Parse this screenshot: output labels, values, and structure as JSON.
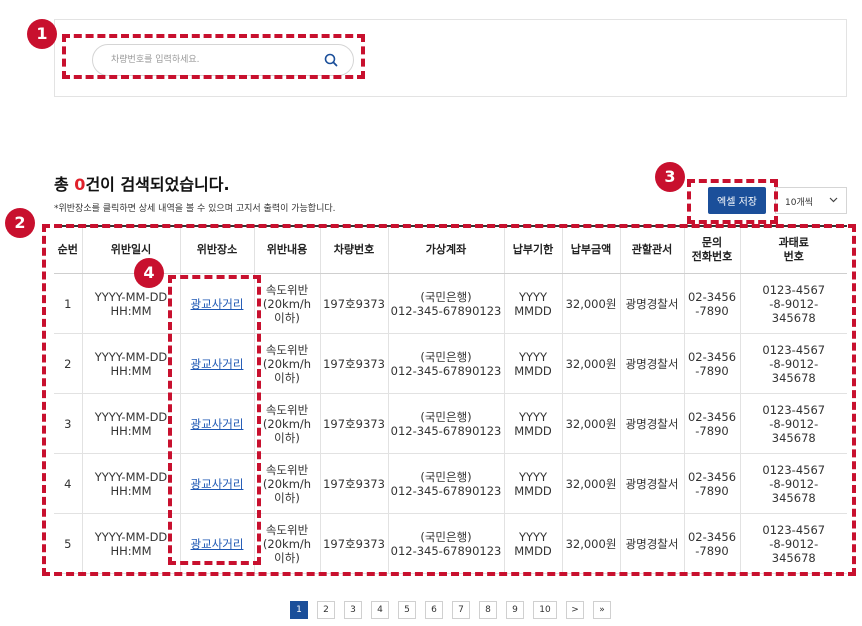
{
  "search": {
    "placeholder": "차량번호를 입력하세요."
  },
  "markers": [
    "1",
    "2",
    "3",
    "4"
  ],
  "results": {
    "title_prefix": "총 ",
    "count": "0",
    "title_suffix": "건이 검색되었습니다.",
    "note": "*위반장소를 클릭하면 상세 내역을 볼 수 있으며 고지서 출력이 가능합니다."
  },
  "toolbar": {
    "excel_label": "엑셀 저장",
    "page_size_label": "10개씩"
  },
  "table": {
    "headers": [
      "순번",
      "위반일시",
      "위반장소",
      "위반내용",
      "차량번호",
      "가상계좌",
      "납부기한",
      "납부금액",
      "관할관서",
      "문의\n전화번호",
      "과태료\n번호"
    ],
    "rows": [
      {
        "no": "1",
        "datetime": "YYYY-MM-DD\nHH:MM",
        "location": "광교사거리",
        "content": "속도위반\n(20km/h 이하)",
        "plate": "197호9373",
        "account": "(국민은행)\n012-345-67890123",
        "due": "YYYY\nMMDD",
        "amount": "32,000원",
        "office": "광명경찰서",
        "phone": "02-3456\n-7890",
        "fine_no": "0123-4567\n-8-9012-\n345678"
      },
      {
        "no": "2",
        "datetime": "YYYY-MM-DD\nHH:MM",
        "location": "광교사거리",
        "content": "속도위반\n(20km/h 이하)",
        "plate": "197호9373",
        "account": "(국민은행)\n012-345-67890123",
        "due": "YYYY\nMMDD",
        "amount": "32,000원",
        "office": "광명경찰서",
        "phone": "02-3456\n-7890",
        "fine_no": "0123-4567\n-8-9012-\n345678"
      },
      {
        "no": "3",
        "datetime": "YYYY-MM-DD\nHH:MM",
        "location": "광교사거리",
        "content": "속도위반\n(20km/h 이하)",
        "plate": "197호9373",
        "account": "(국민은행)\n012-345-67890123",
        "due": "YYYY\nMMDD",
        "amount": "32,000원",
        "office": "광명경찰서",
        "phone": "02-3456\n-7890",
        "fine_no": "0123-4567\n-8-9012-\n345678"
      },
      {
        "no": "4",
        "datetime": "YYYY-MM-DD\nHH:MM",
        "location": "광교사거리",
        "content": "속도위반\n(20km/h 이하)",
        "plate": "197호9373",
        "account": "(국민은행)\n012-345-67890123",
        "due": "YYYY\nMMDD",
        "amount": "32,000원",
        "office": "광명경찰서",
        "phone": "02-3456\n-7890",
        "fine_no": "0123-4567\n-8-9012-\n345678"
      },
      {
        "no": "5",
        "datetime": "YYYY-MM-DD\nHH:MM",
        "location": "광교사거리",
        "content": "속도위반\n(20km/h 이하)",
        "plate": "197호9373",
        "account": "(국민은행)\n012-345-67890123",
        "due": "YYYY\nMMDD",
        "amount": "32,000원",
        "office": "광명경찰서",
        "phone": "02-3456\n-7890",
        "fine_no": "0123-4567\n-8-9012-\n345678"
      }
    ]
  },
  "pagination": {
    "pages": [
      "1",
      "2",
      "3",
      "4",
      "5",
      "6",
      "7",
      "8",
      "9",
      "10"
    ],
    "current": "1",
    "next": ">",
    "last": "»"
  },
  "colors": {
    "accent": "#c8102e",
    "primary": "#1b4f9a",
    "count": "#e0212b",
    "link": "#1d57b3"
  }
}
